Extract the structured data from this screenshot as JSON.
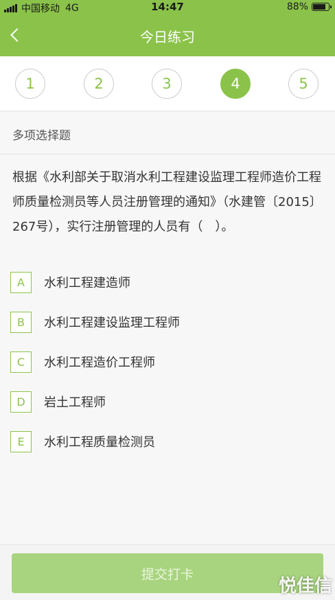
{
  "status_bar": {
    "carrier": "中国移动",
    "network": "4G",
    "time": "14:47",
    "battery_percent": "88%",
    "battery_level": 0.88
  },
  "header": {
    "title": "今日练习",
    "back_icon": "chevron-left-icon"
  },
  "question_nav": {
    "items": [
      "1",
      "2",
      "3",
      "4",
      "5"
    ],
    "active": "4"
  },
  "question": {
    "type_label": "多项选择题",
    "stem": "根据《水利部关于取消水利工程建设监理工程师造价工程师质量检测员等人员注册管理的通知》（水建管〔2015〕267号），实行注册管理的人员有（　）。",
    "options": [
      {
        "letter": "A",
        "text": "水利工程建造师"
      },
      {
        "letter": "B",
        "text": "水利工程建设监理工程师"
      },
      {
        "letter": "C",
        "text": "水利工程造价工程师"
      },
      {
        "letter": "D",
        "text": "岩土工程师"
      },
      {
        "letter": "E",
        "text": "水利工程质量检测员"
      }
    ]
  },
  "footer": {
    "submit_label": "提交打卡"
  },
  "watermark": "悦佳信",
  "colors": {
    "accent": "#8bc34a",
    "submit_bg": "#a9d47f"
  }
}
